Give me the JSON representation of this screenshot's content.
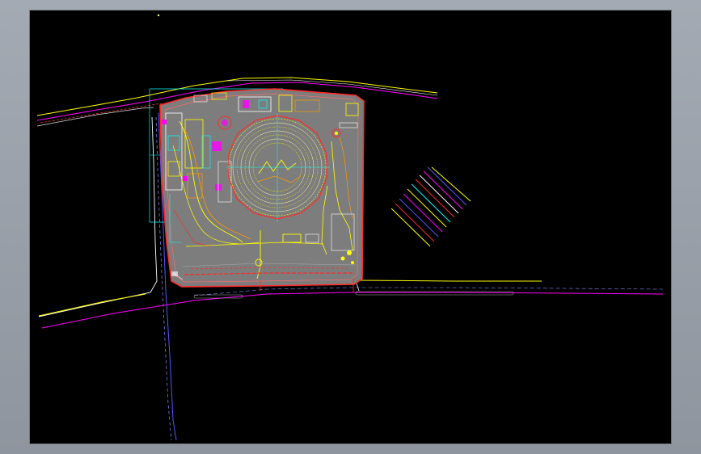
{
  "window": {
    "title": ""
  },
  "colors": {
    "frame": "#9aa1aa",
    "canvas": "#000000",
    "site_fill": "#7d7d7d",
    "line_red": "#ff2b2b",
    "line_yellow": "#ffff00",
    "line_magenta": "#ff00ff",
    "line_cyan": "#00ffff",
    "line_blue": "#5555ff",
    "line_white": "#ffffff"
  },
  "drawing": {
    "description_icon": "cad-site-plan-icon",
    "has_circular_plaza": true,
    "has_parking_rows": true
  }
}
